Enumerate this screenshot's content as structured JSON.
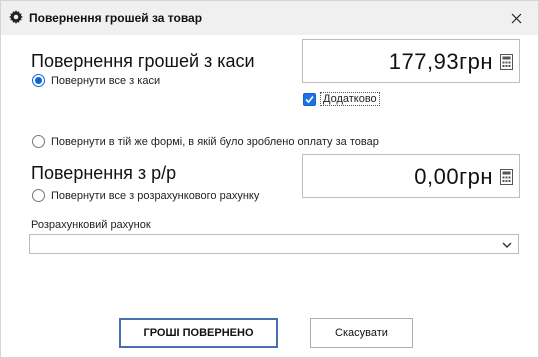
{
  "window": {
    "title": "Повернення грошей за товар",
    "title_icon": "gear-icon",
    "close_icon": "close-icon"
  },
  "cash_section": {
    "title": "Повернення грошей з каси",
    "radio_return_all_label": "Повернути все з каси",
    "radio_return_all_checked": true,
    "amount": "177,93грн",
    "additional_checkbox_label": "Додатково",
    "additional_checked": true
  },
  "same_form": {
    "label": "Повернути в тій же формі, в якій було зроблено оплату за товар",
    "checked": false
  },
  "account_section": {
    "title": "Повернення з р/р",
    "radio_return_all_label": "Повернути все з розрахункового рахунку",
    "radio_return_all_checked": false,
    "amount": "0,00грн"
  },
  "account_field": {
    "label": "Розрахунковий рахунок",
    "value": ""
  },
  "buttons": {
    "confirm": "ГРОШІ ПОВЕРНЕНО",
    "cancel": "Скасувати"
  },
  "colors": {
    "accent": "#0a64d8",
    "checkbox": "#1a73e8",
    "primary_button_border": "#4a6fb0"
  }
}
